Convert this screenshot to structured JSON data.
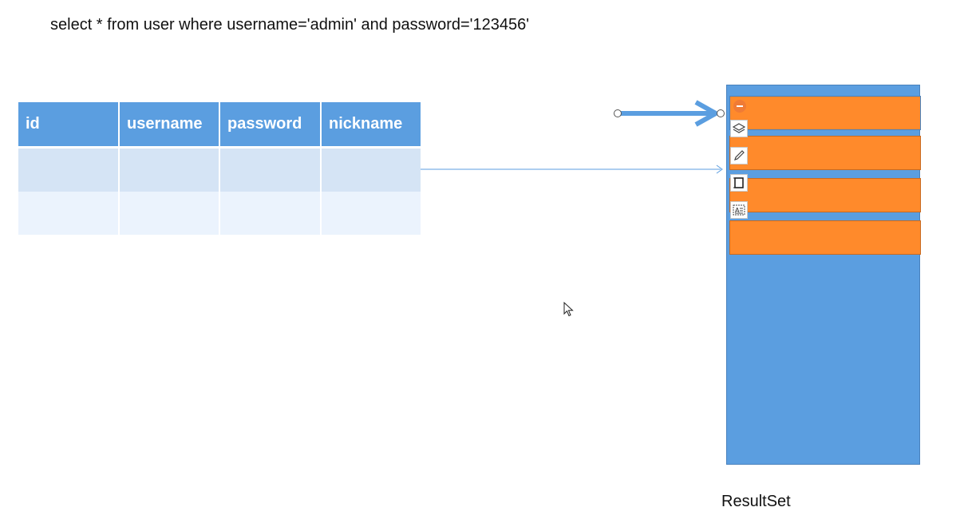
{
  "sql_text": "select * from user where username='admin' and password='123456'",
  "table": {
    "headers": [
      "id",
      "username",
      "password",
      "nickname"
    ],
    "rows": [
      [
        "",
        "",
        "",
        ""
      ],
      [
        "",
        "",
        "",
        ""
      ]
    ]
  },
  "result_set": {
    "label": "ResultSet",
    "row_count": 4
  },
  "colors": {
    "table_header": "#5b9ee0",
    "row_1": "#d5e4f5",
    "row_2": "#ebf3fd",
    "result_set_fill": "#5b9ee0",
    "result_row_fill": "#ff8a2b",
    "arrow": "#5b9ee0"
  },
  "toolbar_icons": [
    "remove-icon",
    "layers-icon",
    "pen-icon",
    "outline-icon",
    "alt-text-icon"
  ]
}
